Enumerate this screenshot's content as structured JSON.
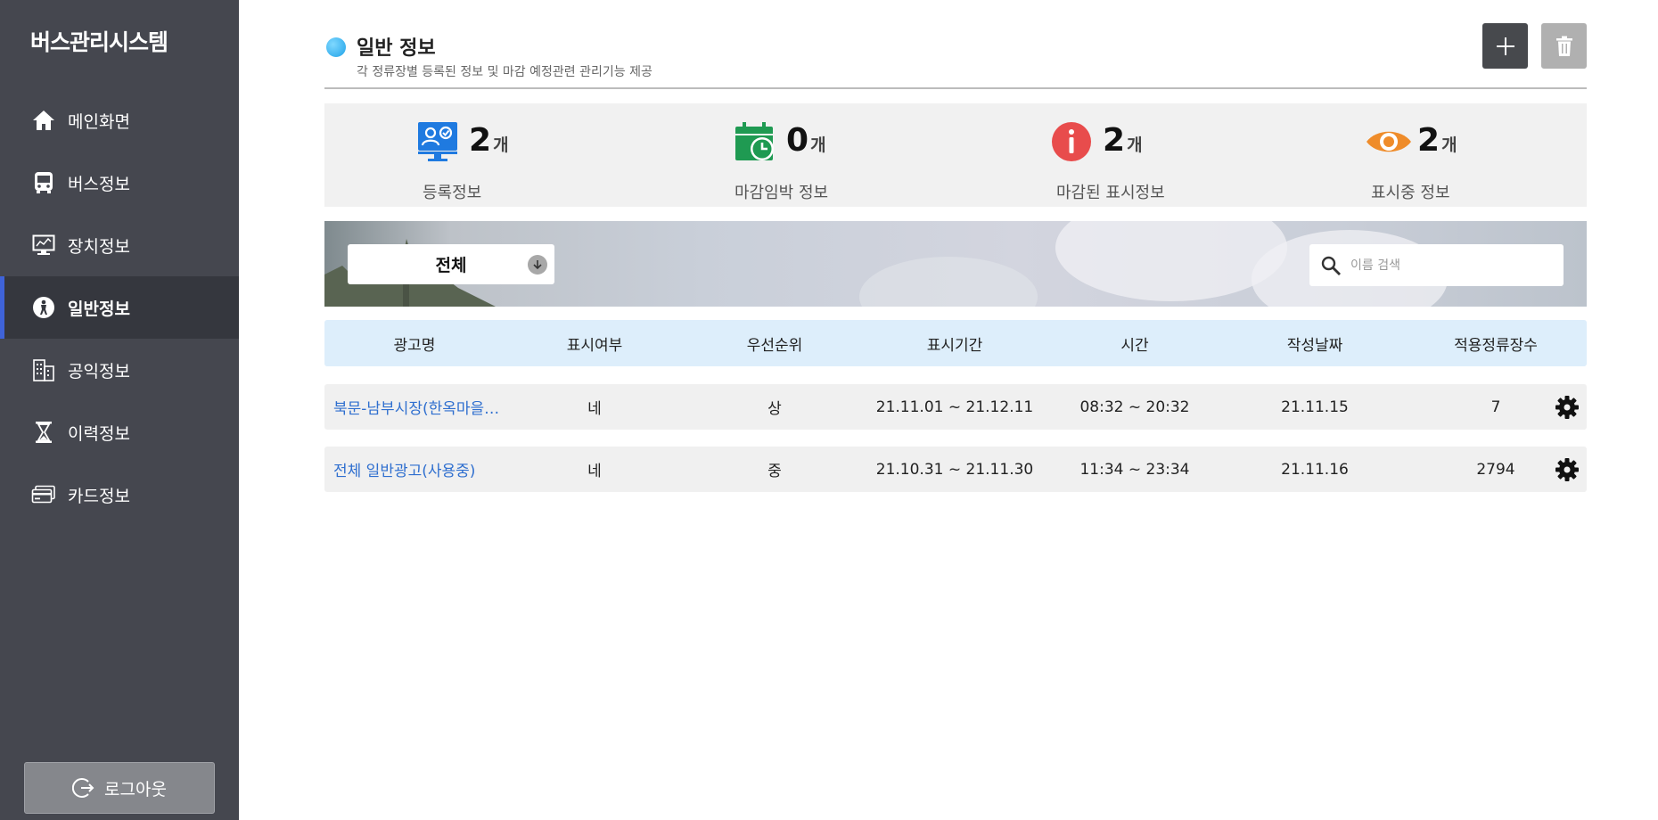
{
  "app": {
    "title": "버스관리시스템"
  },
  "sidebar": {
    "items": [
      {
        "label": "메인화면",
        "icon": "home-icon"
      },
      {
        "label": "버스정보",
        "icon": "bus-icon"
      },
      {
        "label": "장치정보",
        "icon": "monitor-icon"
      },
      {
        "label": "일반정보",
        "icon": "person-circle-icon",
        "active": true
      },
      {
        "label": "공익정보",
        "icon": "building-icon"
      },
      {
        "label": "이력정보",
        "icon": "hourglass-icon"
      },
      {
        "label": "카드정보",
        "icon": "card-icon"
      }
    ],
    "logout_label": "로그아웃"
  },
  "header": {
    "title": "일반 정보",
    "subtitle": "각 정류장별 등록된 정보 및 마감 예정관련 관리기능 제공"
  },
  "stats": [
    {
      "value": "2",
      "unit": "개",
      "label": "등록정보",
      "color": "#1f7ae0",
      "icon": "registered-monitor-icon"
    },
    {
      "value": "0",
      "unit": "개",
      "label": "마감임박 정보",
      "color": "#1f9a52",
      "icon": "calendar-clock-icon"
    },
    {
      "value": "2",
      "unit": "개",
      "label": "마감된 표시정보",
      "color": "#e84c4c",
      "icon": "info-icon"
    },
    {
      "value": "2",
      "unit": "개",
      "label": "표시중 정보",
      "color": "#ef8c2a",
      "icon": "eye-icon"
    }
  ],
  "filter": {
    "selected": "전체"
  },
  "search": {
    "placeholder": "이름 검색",
    "value": ""
  },
  "table": {
    "headers": [
      "광고명",
      "표시여부",
      "우선순위",
      "표시기간",
      "시간",
      "작성날짜",
      "적용정류장수"
    ],
    "rows": [
      [
        "북문-남부시장(한옥마을…",
        "네",
        "상",
        "21.11.01 ~ 21.12.11",
        "08:32 ~ 20:32",
        "21.11.15",
        "7"
      ],
      [
        "전체 일반광고(사용중)",
        "네",
        "중",
        "21.10.31 ~ 21.11.30",
        "11:34 ~ 23:34",
        "21.11.16",
        "2794"
      ]
    ]
  },
  "colors": {
    "sidebar": "#45474f",
    "active_accent": "#3f63d8",
    "table_header": "#ddeefb",
    "link": "#2f6fcf"
  }
}
